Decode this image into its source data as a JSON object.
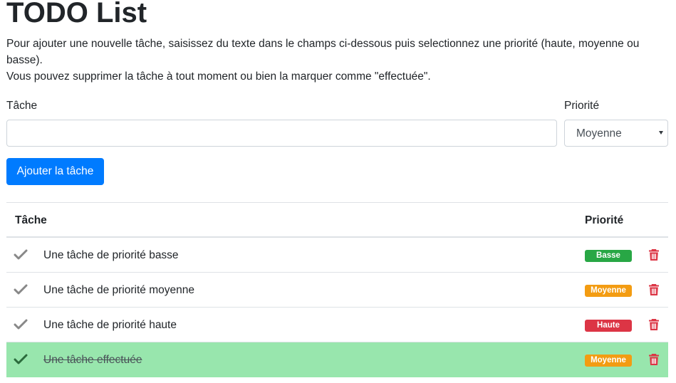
{
  "header": {
    "title": "TODO List",
    "intro_line1": "Pour ajouter une nouvelle tâche, saisissez du texte dans le champs ci-dessous puis selectionnez une priorité (haute, moyenne ou basse).",
    "intro_line2": "Vous pouvez supprimer la tâche à tout moment ou bien la marquer comme \"effectuée\"."
  },
  "form": {
    "task_label": "Tâche",
    "task_value": "",
    "priority_label": "Priorité",
    "priority_selected": "Moyenne",
    "add_button": "Ajouter la tâche"
  },
  "table": {
    "headers": {
      "task": "Tâche",
      "priority": "Priorité"
    },
    "rows": [
      {
        "text": "Une tâche de priorité basse",
        "priority": "Basse",
        "priority_color": "#28a745",
        "done": false
      },
      {
        "text": "Une tâche de priorité moyenne",
        "priority": "Moyenne",
        "priority_color": "#f39c12",
        "done": false
      },
      {
        "text": "Une tâche de priorité haute",
        "priority": "Haute",
        "priority_color": "#dc3545",
        "done": false
      },
      {
        "text": "Une tâche effectuée",
        "priority": "Moyenne",
        "priority_color": "#f39c12",
        "done": true
      }
    ]
  },
  "colors": {
    "primary": "#007bff",
    "done_row": "#98e6ad",
    "check_default": "#888888",
    "check_done": "#2b6b3c",
    "trash": "#dc3545"
  },
  "icons": {
    "check": "check-icon",
    "delete": "trash-icon"
  }
}
